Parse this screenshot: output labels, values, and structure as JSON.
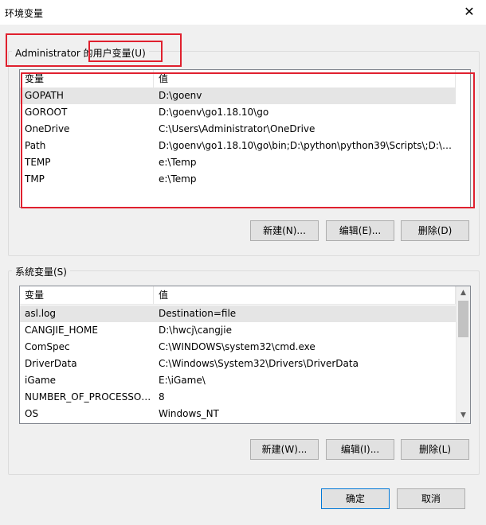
{
  "window": {
    "title": "环境变量",
    "close_glyph": "✕"
  },
  "user_vars": {
    "label": "Administrator 的用户变量(U)",
    "columns": [
      "变量",
      "值"
    ],
    "rows": [
      {
        "name": "GOPATH",
        "value": "D:\\goenv"
      },
      {
        "name": "GOROOT",
        "value": "D:\\goenv\\go1.18.10\\go"
      },
      {
        "name": "OneDrive",
        "value": "C:\\Users\\Administrator\\OneDrive"
      },
      {
        "name": "Path",
        "value": "D:\\goenv\\go1.18.10\\go\\bin;D:\\python\\python39\\Scripts\\;D:\\p..."
      },
      {
        "name": "TEMP",
        "value": "e:\\Temp"
      },
      {
        "name": "TMP",
        "value": "e:\\Temp"
      }
    ],
    "buttons": {
      "new": "新建(N)...",
      "edit": "编辑(E)...",
      "delete": "删除(D)"
    }
  },
  "system_vars": {
    "label": "系统变量(S)",
    "columns": [
      "变量",
      "值"
    ],
    "rows": [
      {
        "name": "asl.log",
        "value": "Destination=file"
      },
      {
        "name": "CANGJIE_HOME",
        "value": "D:\\hwcj\\cangjie"
      },
      {
        "name": "ComSpec",
        "value": "C:\\WINDOWS\\system32\\cmd.exe"
      },
      {
        "name": "DriverData",
        "value": "C:\\Windows\\System32\\Drivers\\DriverData"
      },
      {
        "name": "iGame",
        "value": "E:\\iGame\\"
      },
      {
        "name": "NUMBER_OF_PROCESSORS",
        "value": "8"
      },
      {
        "name": "OS",
        "value": "Windows_NT"
      }
    ],
    "buttons": {
      "new": "新建(W)...",
      "edit": "编辑(I)...",
      "delete": "删除(L)"
    }
  },
  "footer": {
    "ok": "确定",
    "cancel": "取消"
  },
  "colors": {
    "highlight": "#e0202e",
    "selected_row": "#e5e5e5"
  },
  "icons": {
    "scroll_up": "chevron-up-icon",
    "scroll_down": "chevron-down-icon"
  }
}
